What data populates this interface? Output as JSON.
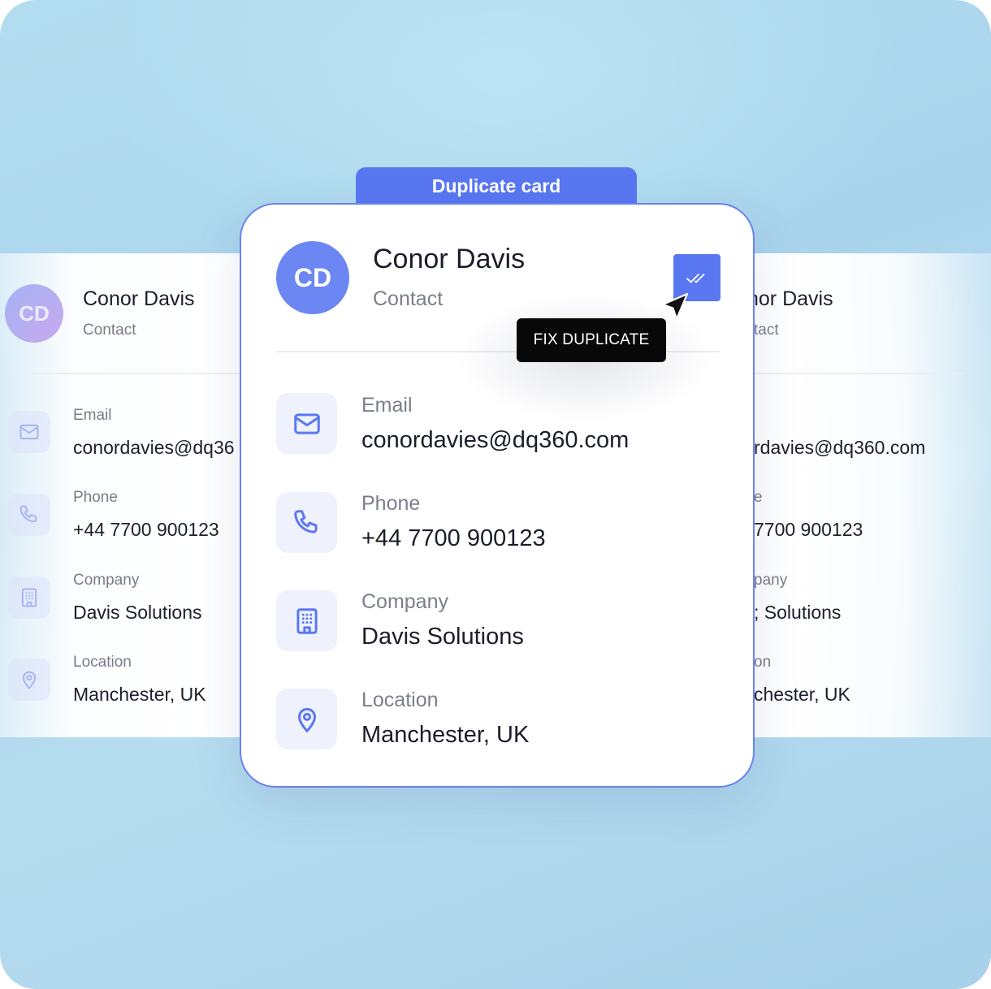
{
  "card_tab": "Duplicate card",
  "contact": {
    "initials": "CD",
    "name": "Conor Davis",
    "role": "Contact"
  },
  "fields": {
    "email": {
      "label": "Email",
      "value": "conordavies@dq360.com",
      "icon": "mail-icon"
    },
    "phone": {
      "label": "Phone",
      "value": "+44 7700 900123",
      "icon": "phone-icon"
    },
    "company": {
      "label": "Company",
      "value": "Davis Solutions",
      "icon": "building-icon"
    },
    "location": {
      "label": "Location",
      "value": "Manchester, UK",
      "icon": "map-pin-icon"
    }
  },
  "left_card": {
    "initials": "CD",
    "name": "Conor Davis",
    "role": "Contact",
    "email_label": "Email",
    "email_value": "conordavies@dq36",
    "phone_label": "Phone",
    "phone_value": "+44 7700 900123",
    "company_label": "Company",
    "company_value": "Davis Solutions",
    "location_label": "Location",
    "location_value": "Manchester, UK"
  },
  "right_card": {
    "name": "nor Davis",
    "role": "tact",
    "email_value": "rdavies@dq360.com",
    "phone_label": "e",
    "phone_value": "7700 900123",
    "company_label": "pany",
    "company_value": "; Solutions",
    "location_label": "on",
    "location_value": "chester, UK"
  },
  "check_button_icon": "double-check-icon",
  "tooltip": "FIX DUPLICATE",
  "colors": {
    "accent": "#5a77f2",
    "avatar": "#6c86f3",
    "icon_bg": "#eff2fd",
    "text": "#1b1d29",
    "muted": "#7c7f8a",
    "background": "#acd6ed"
  }
}
